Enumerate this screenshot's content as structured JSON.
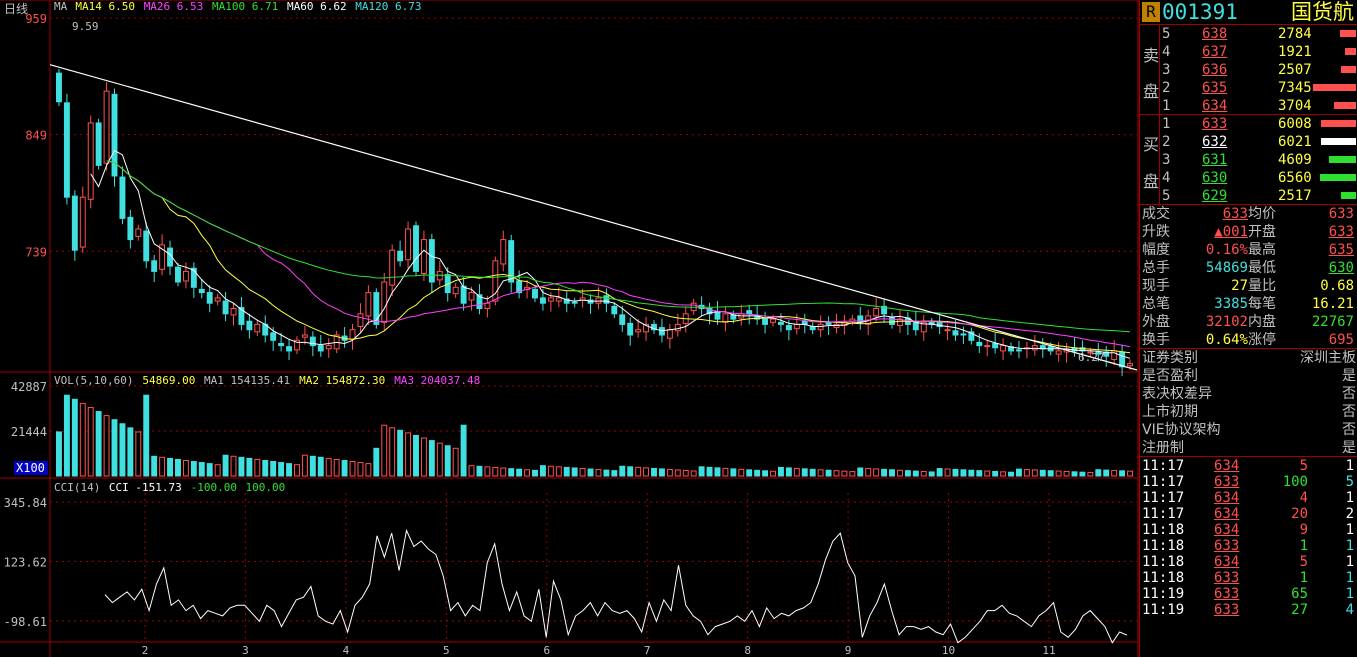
{
  "period_label": "日线",
  "ma_legend": [
    {
      "text": "MA",
      "color": "#c0c0c0"
    },
    {
      "text": "MA14 6.50",
      "color": "#ffff40"
    },
    {
      "text": "MA26 6.53",
      "color": "#ff40ff"
    },
    {
      "text": "MA100 6.71",
      "color": "#30e030"
    },
    {
      "text": "MA60 6.62",
      "color": "#ffffff"
    },
    {
      "text": "MA120 6.73",
      "color": "#40e0e0"
    }
  ],
  "price_axis": [
    "959",
    "849",
    "739"
  ],
  "high_label": "9.59",
  "low_label": "6.27",
  "vol_legend": [
    {
      "text": "VOL(5,10,60)",
      "color": "#c0c0c0"
    },
    {
      "text": "54869.00",
      "color": "#ffff40"
    },
    {
      "text": "MA1 154135.41",
      "color": "#c0c0c0"
    },
    {
      "text": "MA2 154872.30",
      "color": "#ffff40"
    },
    {
      "text": "MA3 204037.48",
      "color": "#ff40ff"
    }
  ],
  "vol_axis": [
    "42887",
    "21444"
  ],
  "vol_unit": "X100",
  "cci_legend": [
    {
      "text": "CCI(14)",
      "color": "#c0c0c0"
    },
    {
      "text": "CCI -151.73",
      "color": "#ffffff"
    },
    {
      "text": "-100.00",
      "color": "#30e030"
    },
    {
      "text": "100.00",
      "color": "#30e030"
    }
  ],
  "cci_axis": [
    "345.84",
    "123.62",
    "-98.61"
  ],
  "x_axis": [
    "2",
    "3",
    "4",
    "5",
    "6",
    "7",
    "8",
    "9",
    "10",
    "11"
  ],
  "quote": {
    "badge": "R",
    "code": "001391",
    "name": "国货航",
    "sell_label": [
      "卖",
      "盘"
    ],
    "buy_label": [
      "买",
      "盘"
    ],
    "asks": [
      {
        "lvl": "5",
        "price": "638",
        "vol": "2784"
      },
      {
        "lvl": "4",
        "price": "637",
        "vol": "1921"
      },
      {
        "lvl": "3",
        "price": "636",
        "vol": "2507"
      },
      {
        "lvl": "2",
        "price": "635",
        "vol": "7345"
      },
      {
        "lvl": "1",
        "price": "634",
        "vol": "3704"
      }
    ],
    "bids": [
      {
        "lvl": "1",
        "price": "633",
        "vol": "6008"
      },
      {
        "lvl": "2",
        "price": "632",
        "vol": "6021"
      },
      {
        "lvl": "3",
        "price": "631",
        "vol": "4609"
      },
      {
        "lvl": "4",
        "price": "630",
        "vol": "6560"
      },
      {
        "lvl": "5",
        "price": "629",
        "vol": "2517"
      }
    ],
    "stats": [
      [
        "成交",
        "633",
        "均价",
        "633"
      ],
      [
        "升跌",
        "▲001",
        "开盘",
        "633"
      ],
      [
        "幅度",
        "0.16%",
        "最高",
        "635"
      ],
      [
        "总手",
        "54869",
        "最低",
        "630"
      ],
      [
        "现手",
        "27",
        "量比",
        "0.68"
      ],
      [
        "总笔",
        "3385",
        "每笔",
        "16.21"
      ],
      [
        "外盘",
        "32102",
        "内盘",
        "22767"
      ],
      [
        "换手",
        "0.64%",
        "涨停",
        "695"
      ]
    ],
    "info": [
      [
        "证券类别",
        "深圳主板"
      ],
      [
        "是否盈利",
        "是"
      ],
      [
        "表决权差异",
        "否"
      ],
      [
        "上市初期",
        "否"
      ],
      [
        "VIE协议架构",
        "否"
      ],
      [
        "注册制",
        "是"
      ]
    ],
    "ticks": [
      {
        "time": "11:17",
        "price": "634",
        "vol": "5",
        "n": "1",
        "dir": "up"
      },
      {
        "time": "11:17",
        "price": "633",
        "vol": "100",
        "n": "5",
        "dir": "down"
      },
      {
        "time": "11:17",
        "price": "634",
        "vol": "4",
        "n": "1",
        "dir": "up"
      },
      {
        "time": "11:17",
        "price": "634",
        "vol": "20",
        "n": "2",
        "dir": "up"
      },
      {
        "time": "11:18",
        "price": "634",
        "vol": "9",
        "n": "1",
        "dir": "up"
      },
      {
        "time": "11:18",
        "price": "633",
        "vol": "1",
        "n": "1",
        "dir": "down"
      },
      {
        "time": "11:18",
        "price": "634",
        "vol": "5",
        "n": "1",
        "dir": "up"
      },
      {
        "time": "11:18",
        "price": "633",
        "vol": "1",
        "n": "1",
        "dir": "down"
      },
      {
        "time": "11:19",
        "price": "633",
        "vol": "65",
        "n": "1",
        "dir": "down"
      },
      {
        "time": "11:19",
        "price": "633",
        "vol": "27",
        "n": "4",
        "dir": "down"
      }
    ]
  },
  "chart_data": {
    "type": "candlestick",
    "price_ylim": [
      6.27,
      9.59
    ],
    "closes": [
      8.8,
      7.9,
      7.4,
      7.9,
      8.6,
      8.2,
      8.9,
      8.1,
      7.7,
      7.5,
      7.6,
      7.3,
      7.2,
      7.45,
      7.25,
      7.1,
      7.2,
      7.05,
      7.0,
      6.9,
      6.95,
      6.8,
      6.85,
      6.7,
      6.65,
      6.7,
      6.6,
      6.55,
      6.5,
      6.45,
      6.55,
      6.6,
      6.5,
      6.45,
      6.5,
      6.6,
      6.55,
      6.65,
      6.8,
      7.0,
      6.7,
      7.1,
      7.4,
      7.3,
      7.6,
      7.2,
      7.5,
      7.1,
      7.2,
      7.0,
      7.05,
      6.9,
      7.0,
      6.85,
      6.9,
      7.3,
      7.5,
      7.1,
      7.0,
      7.05,
      6.95,
      6.9,
      6.95,
      6.95,
      6.9,
      6.9,
      6.95,
      6.9,
      6.95,
      6.9,
      6.8,
      6.7,
      6.6,
      6.65,
      6.7,
      6.65,
      6.6,
      6.65,
      6.7,
      6.8,
      6.9,
      6.85,
      6.8,
      6.75,
      6.8,
      6.75,
      6.8,
      6.8,
      6.75,
      6.7,
      6.75,
      6.7,
      6.65,
      6.7,
      6.7,
      6.65,
      6.7,
      6.7,
      6.7,
      6.72,
      6.75,
      6.72,
      6.78,
      6.85,
      6.8,
      6.7,
      6.75,
      6.7,
      6.65,
      6.72,
      6.7,
      6.68,
      6.65,
      6.6,
      6.6,
      6.55,
      6.5,
      6.5,
      6.48,
      6.5,
      6.45,
      6.45,
      6.48,
      6.5,
      6.47,
      6.45,
      6.45,
      6.47,
      6.45,
      6.45,
      6.44,
      6.42,
      6.4,
      6.45,
      6.3,
      6.33
    ],
    "cci": [
      0,
      -30,
      -10,
      10,
      -20,
      20,
      -60,
      40,
      100,
      -40,
      -20,
      -60,
      -40,
      -90,
      -60,
      -70,
      -80,
      -50,
      -40,
      -40,
      -70,
      -100,
      -40,
      -60,
      -120,
      -70,
      -20,
      -10,
      30,
      -80,
      -100,
      -110,
      -60,
      -140,
      -40,
      -10,
      40,
      220,
      140,
      230,
      90,
      240,
      180,
      200,
      170,
      150,
      70,
      -60,
      -30,
      -80,
      -40,
      -60,
      120,
      190,
      40,
      -60,
      10,
      -80,
      -100,
      20,
      -160,
      50,
      -20,
      -150,
      -80,
      -60,
      -30,
      -80,
      -30,
      -60,
      -70,
      -60,
      -90,
      -140,
      -30,
      -100,
      -20,
      -60,
      110,
      -40,
      -80,
      -100,
      -150,
      -120,
      -110,
      -100,
      -80,
      -100,
      -60,
      -120,
      -50,
      -90,
      -70,
      -80,
      -60,
      -50,
      -30,
      40,
      130,
      200,
      230,
      120,
      70,
      -160,
      -80,
      -30,
      40,
      -60,
      -150,
      -120,
      -120,
      -130,
      -120,
      -140,
      -150,
      -110,
      -180,
      -160,
      -130,
      -100,
      -60,
      -60,
      -40,
      -70,
      -80,
      -100,
      -120,
      -80,
      -60,
      -30,
      -140,
      -160,
      -130,
      -80,
      -60,
      -90,
      -120,
      -180,
      -140,
      -151.73
    ],
    "cci_ylim": [
      -170,
      380
    ],
    "vol_ylim": [
      0,
      42887
    ],
    "ma_last": {
      "MA14": 6.5,
      "MA26": 6.53,
      "MA100": 6.71,
      "MA60": 6.62,
      "MA120": 6.73
    },
    "x_ticks": [
      "2",
      "3",
      "4",
      "5",
      "6",
      "7",
      "8",
      "9",
      "10",
      "11"
    ]
  }
}
